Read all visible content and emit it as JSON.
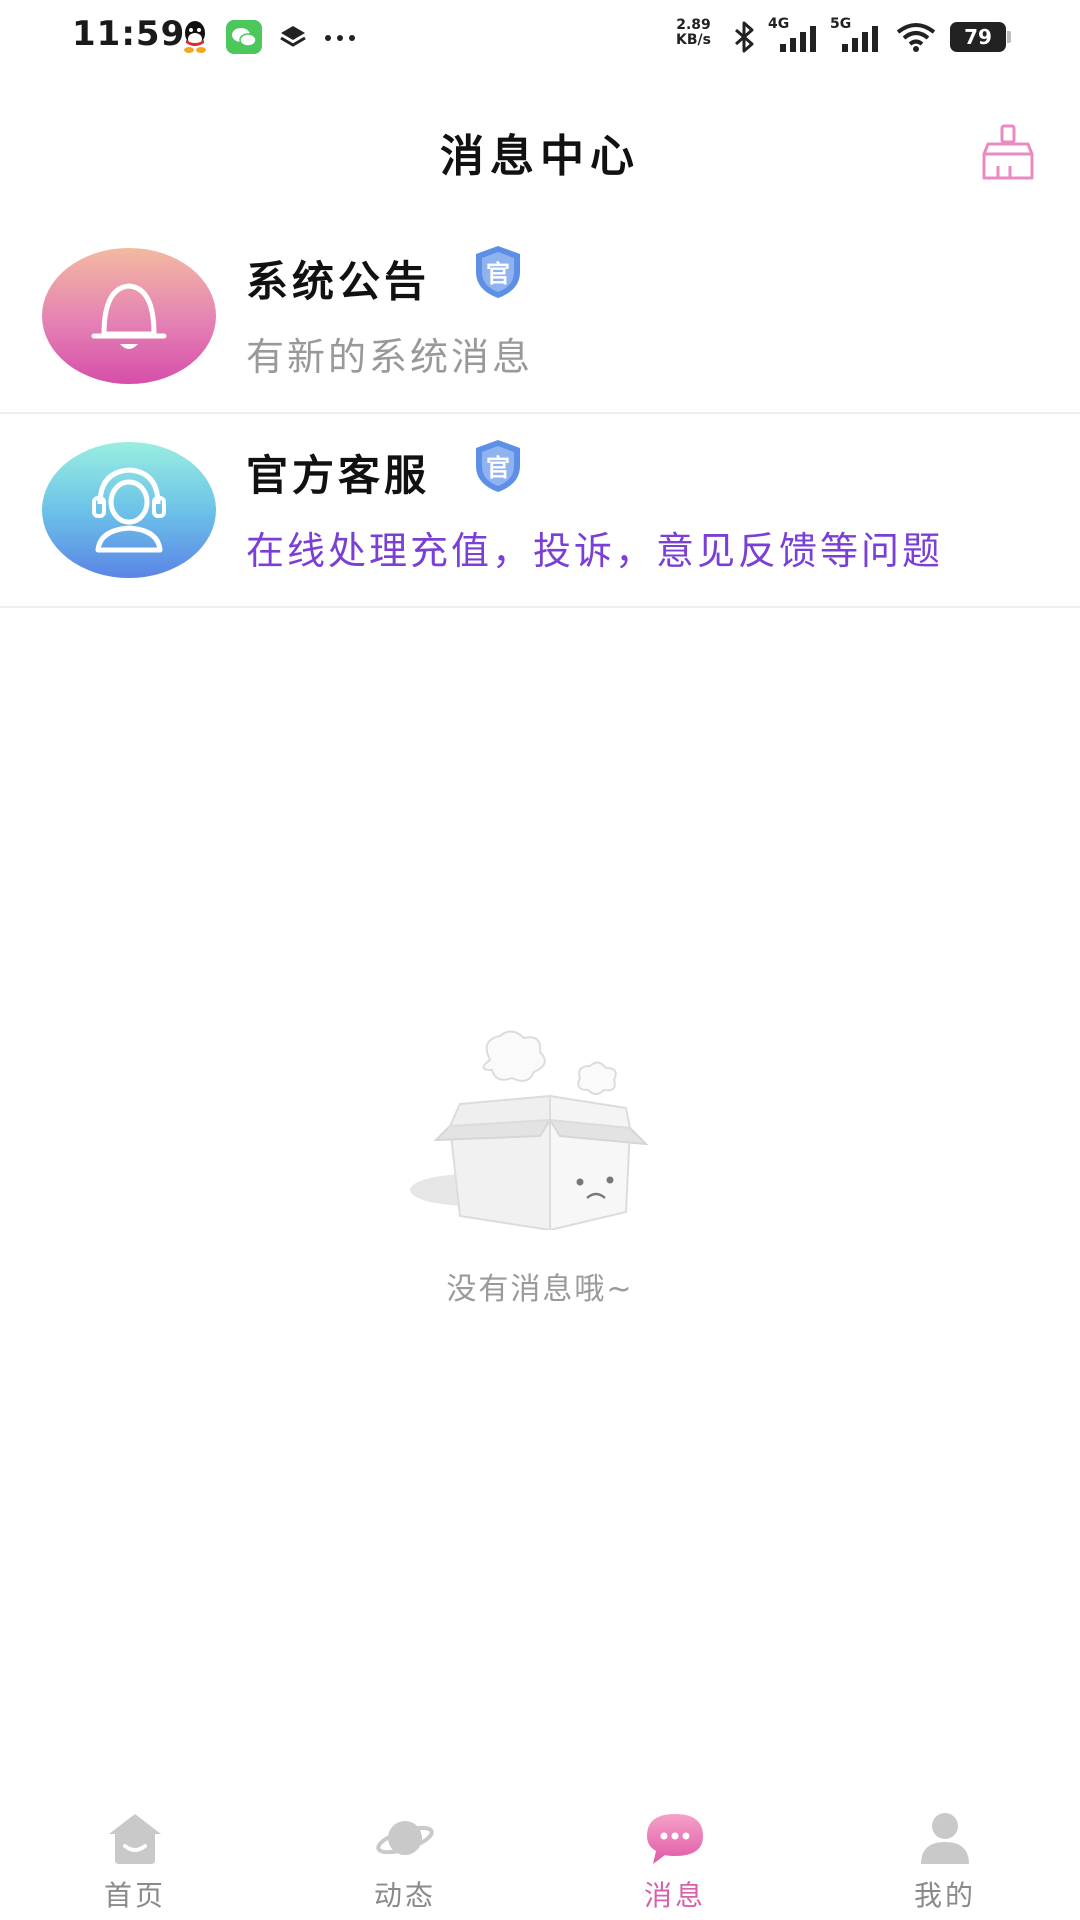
{
  "status_bar": {
    "time": "11:59",
    "net_speed_value": "2.89",
    "net_speed_unit": "KB/s",
    "network_4g": "4G",
    "network_5g": "5G",
    "battery": "79",
    "notification_icons": [
      "qq-icon",
      "wechat-icon",
      "layers-icon",
      "more-dots-icon"
    ]
  },
  "header": {
    "title": "消息中心",
    "clear_icon": "broom-icon"
  },
  "messages": [
    {
      "title": "系统公告",
      "badge": "官",
      "subtitle": "有新的系统消息",
      "icon": "bell-icon"
    },
    {
      "title": "官方客服",
      "badge": "官",
      "subtitle": "在线处理充值，投诉，意见反馈等问题",
      "icon": "customer-service-icon"
    }
  ],
  "empty_state": {
    "text": "没有消息哦~"
  },
  "bottom_nav": {
    "items": [
      {
        "label": "首页",
        "icon": "home-icon",
        "active": false
      },
      {
        "label": "动态",
        "icon": "planet-icon",
        "active": false
      },
      {
        "label": "消息",
        "icon": "chat-bubble-icon",
        "active": true
      },
      {
        "label": "我的",
        "icon": "person-icon",
        "active": false
      }
    ]
  },
  "colors": {
    "accent": "#d861a8",
    "link_purple": "#7a3fd6",
    "subtitle_gray": "#999999",
    "badge_blue": "#4d7fd8"
  }
}
